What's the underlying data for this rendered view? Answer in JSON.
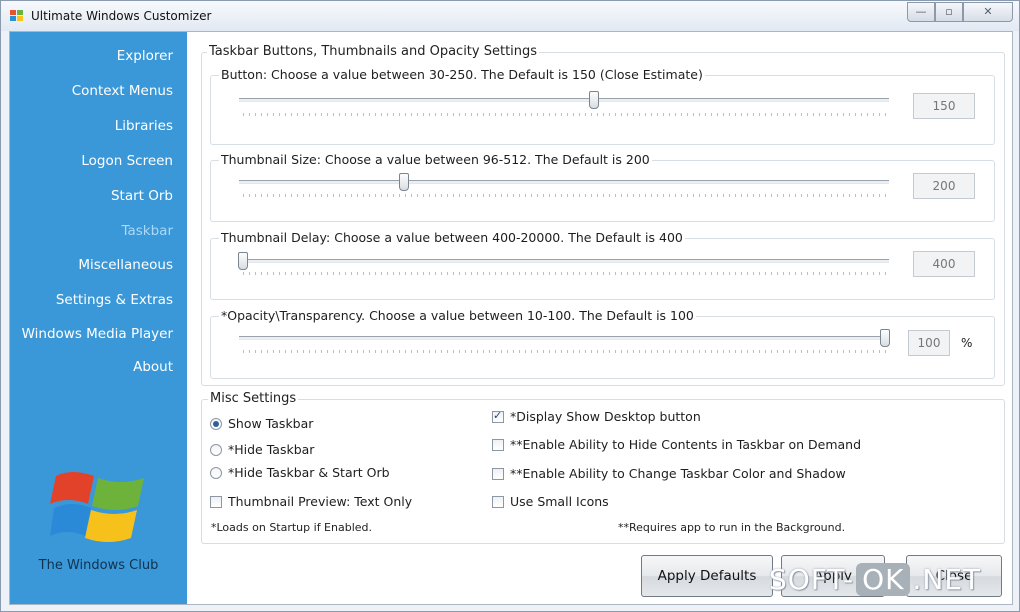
{
  "window": {
    "title": "Ultimate Windows Customizer",
    "controls": {
      "minimize": "—",
      "maximize": "▫",
      "close": "✕"
    }
  },
  "sidebar": {
    "items": [
      {
        "label": "Explorer",
        "active": false
      },
      {
        "label": "Context Menus",
        "active": false
      },
      {
        "label": "Libraries",
        "active": false
      },
      {
        "label": "Logon Screen",
        "active": false
      },
      {
        "label": "Start Orb",
        "active": false
      },
      {
        "label": "Taskbar",
        "active": true
      },
      {
        "label": "Miscellaneous",
        "active": false
      },
      {
        "label": "Settings & Extras",
        "active": false
      },
      {
        "label": "Windows Media Player",
        "active": false
      },
      {
        "label": "About",
        "active": false
      }
    ],
    "footer": "The Windows Club",
    "colors": {
      "background": "#3a98d8",
      "active_text": "#a9d9f6"
    }
  },
  "taskbar_group": {
    "title": "Taskbar Buttons, Thumbnails and Opacity Settings",
    "sliders": [
      {
        "label": "Button: Choose a value between 30-250. The Default is 150 (Close Estimate)",
        "value": "150",
        "min": 30,
        "max": 250,
        "unit": ""
      },
      {
        "label": "Thumbnail Size: Choose a value between 96-512. The Default is 200",
        "value": "200",
        "min": 96,
        "max": 512,
        "unit": ""
      },
      {
        "label": "Thumbnail Delay: Choose a value between 400-20000. The Default is 400",
        "value": "400",
        "min": 400,
        "max": 20000,
        "unit": ""
      },
      {
        "label": "*Opacity\\Transparency. Choose a value between 10-100. The Default is 100",
        "value": "100",
        "min": 10,
        "max": 100,
        "unit": "%"
      }
    ]
  },
  "misc_group": {
    "title": "Misc Settings",
    "radios": [
      {
        "label": "Show Taskbar",
        "checked": true
      },
      {
        "label": "*Hide Taskbar",
        "checked": false
      },
      {
        "label": "*Hide Taskbar & Start Orb",
        "checked": false
      }
    ],
    "left_checks": [
      {
        "label": "Thumbnail Preview: Text Only",
        "checked": false
      }
    ],
    "right_checks": [
      {
        "label": "*Display Show Desktop button",
        "checked": true
      },
      {
        "label": "**Enable Ability to Hide Contents in Taskbar on Demand",
        "checked": false
      },
      {
        "label": "**Enable Ability to Change Taskbar Color and Shadow",
        "checked": false
      },
      {
        "label": "Use Small Icons",
        "checked": false
      }
    ],
    "note_left": "*Loads on Startup if Enabled.",
    "note_right": "**Requires app to run in the Background."
  },
  "buttons": {
    "apply_defaults": "Apply Defaults",
    "apply": "Apply",
    "close": "Close"
  },
  "watermark": {
    "pre": "SOFT-",
    "mid": "OK",
    "post": ".NET"
  }
}
